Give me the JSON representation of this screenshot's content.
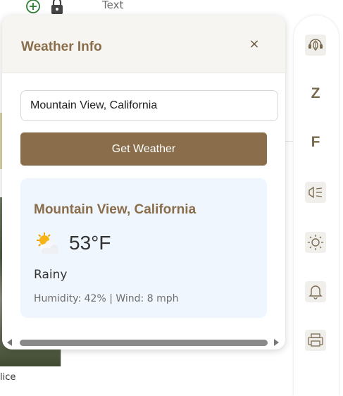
{
  "background": {
    "toolbar_text_label": "Text",
    "bottom_text": "lice"
  },
  "right_bar": {
    "letter_z": "Z",
    "letter_f": "F"
  },
  "weather_panel": {
    "title": "Weather Info",
    "close_label": "×",
    "city_input_value": "Mountain View, California",
    "get_weather_label": "Get Weather",
    "result": {
      "city": "Mountain View, California",
      "icon": "sun-behind-cloud-icon",
      "temperature": "53°F",
      "condition": "Rainy",
      "details": "Humidity: 42% | Wind: 8 mph"
    }
  },
  "colors": {
    "accent": "#8a6d4a",
    "card_background": "#f0f6fe",
    "header_background": "#f7f5f2"
  }
}
